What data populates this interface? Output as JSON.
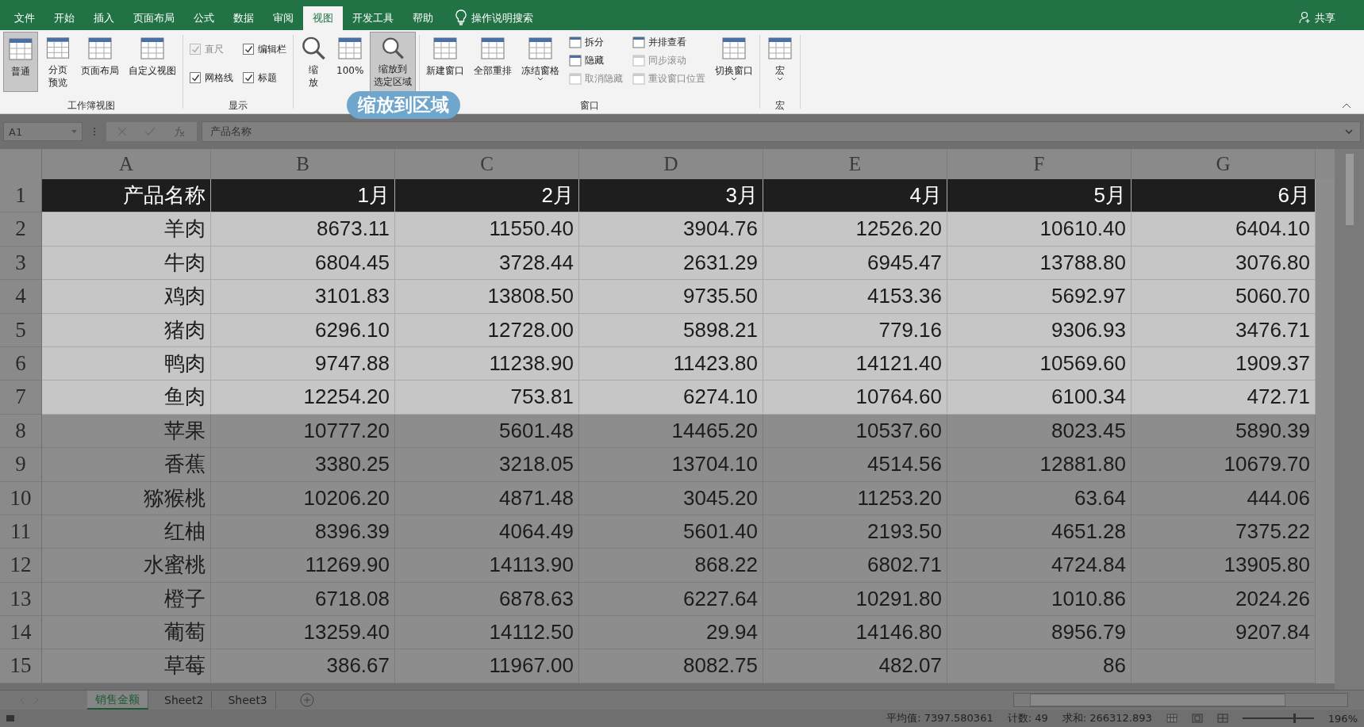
{
  "tabs": [
    {
      "label": "文件",
      "selected": false
    },
    {
      "label": "开始",
      "selected": false
    },
    {
      "label": "插入",
      "selected": false
    },
    {
      "label": "页面布局",
      "selected": false
    },
    {
      "label": "公式",
      "selected": false
    },
    {
      "label": "数据",
      "selected": false
    },
    {
      "label": "审阅",
      "selected": false
    },
    {
      "label": "视图",
      "selected": true
    },
    {
      "label": "开发工具",
      "selected": false
    },
    {
      "label": "帮助",
      "selected": false
    }
  ],
  "tell_me": "操作说明搜索",
  "share": "共享",
  "ribbon_groups": [
    {
      "label": "工作簿视图",
      "columns": [
        [
          {
            "kind": "large",
            "label": [
              "普通"
            ],
            "selected": true,
            "caret": false
          }
        ],
        [
          {
            "kind": "large",
            "label": [
              "分页",
              "预览"
            ],
            "selected": false,
            "caret": false
          }
        ],
        [
          {
            "kind": "large",
            "label": [
              "页面布局"
            ],
            "selected": false,
            "caret": false
          }
        ],
        [
          {
            "kind": "large",
            "label": [
              "自定义视图"
            ],
            "selected": false,
            "caret": false
          }
        ]
      ]
    },
    {
      "label": "显示",
      "columns": [
        [
          {
            "kind": "check",
            "label": "直尺",
            "checked": true,
            "disabled": true
          },
          {
            "kind": "check",
            "label": "网格线",
            "checked": true,
            "disabled": false
          }
        ],
        [
          {
            "kind": "check",
            "label": "编辑栏",
            "checked": true,
            "disabled": false
          },
          {
            "kind": "check",
            "label": "标题",
            "checked": true,
            "disabled": false
          }
        ]
      ]
    },
    {
      "columns": [
        [
          {
            "kind": "zoom",
            "label": [
              "缩",
              "放"
            ],
            "selected": false,
            "caret": false
          }
        ],
        [
          {
            "kind": "large",
            "label": [
              "100%"
            ],
            "selected": false,
            "caret": false
          }
        ],
        [
          {
            "kind": "zoom",
            "label": [
              "缩放到",
              "选定区域"
            ],
            "selected": true,
            "caret": false
          }
        ]
      ]
    },
    {
      "label": "窗口",
      "columns": [
        [
          {
            "kind": "large",
            "label": [
              "新建窗口"
            ],
            "selected": false,
            "caret": false
          }
        ],
        [
          {
            "kind": "large",
            "label": [
              "全部重排"
            ],
            "selected": false,
            "caret": false
          }
        ],
        [
          {
            "kind": "large",
            "label": [
              "冻结窗格"
            ],
            "selected": false,
            "caret": true
          }
        ],
        [
          {
            "kind": "small",
            "label": "拆分",
            "disabled": false
          },
          {
            "kind": "small",
            "label": "隐藏",
            "disabled": false
          },
          {
            "kind": "small",
            "label": "取消隐藏",
            "disabled": true
          }
        ],
        [
          {
            "kind": "small",
            "label": "并排查看",
            "disabled": false
          },
          {
            "kind": "small",
            "label": "同步滚动",
            "disabled": true
          },
          {
            "kind": "small",
            "label": "重设窗口位置",
            "disabled": true
          }
        ],
        [
          {
            "kind": "large",
            "label": [
              "切换窗口"
            ],
            "selected": false,
            "caret": true
          }
        ]
      ]
    },
    {
      "label": "宏",
      "columns": [
        [
          {
            "kind": "large",
            "label": [
              "宏"
            ],
            "selected": false,
            "caret": true
          }
        ]
      ]
    }
  ],
  "callout": "缩放到区域",
  "formula_bar": {
    "name_box": "A1",
    "content": "产品名称"
  },
  "columns": [
    "A",
    "B",
    "C",
    "D",
    "E",
    "F",
    "G"
  ],
  "rows": [
    {
      "number": "1",
      "kind": "header",
      "selected": true,
      "cells": [
        "产品名称",
        "1月",
        "2月",
        "3月",
        "4月",
        "5月",
        "6月"
      ]
    },
    {
      "number": "2",
      "kind": "data",
      "selected": true,
      "cells": [
        "羊肉",
        "8673.11",
        "11550.40",
        "3904.76",
        "12526.20",
        "10610.40",
        "6404.10"
      ]
    },
    {
      "number": "3",
      "kind": "data",
      "selected": true,
      "cells": [
        "牛肉",
        "6804.45",
        "3728.44",
        "2631.29",
        "6945.47",
        "13788.80",
        "3076.80"
      ]
    },
    {
      "number": "4",
      "kind": "data",
      "selected": true,
      "cells": [
        "鸡肉",
        "3101.83",
        "13808.50",
        "9735.50",
        "4153.36",
        "5692.97",
        "5060.70"
      ]
    },
    {
      "number": "5",
      "kind": "data",
      "selected": true,
      "cells": [
        "猪肉",
        "6296.10",
        "12728.00",
        "5898.21",
        "779.16",
        "9306.93",
        "3476.71"
      ]
    },
    {
      "number": "6",
      "kind": "data",
      "selected": true,
      "cells": [
        "鸭肉",
        "9747.88",
        "11238.90",
        "11423.80",
        "14121.40",
        "10569.60",
        "1909.37"
      ]
    },
    {
      "number": "7",
      "kind": "data",
      "selected": true,
      "cells": [
        "鱼肉",
        "12254.20",
        "753.81",
        "6274.10",
        "10764.60",
        "6100.34",
        "472.71"
      ]
    },
    {
      "number": "8",
      "kind": "data",
      "selected": false,
      "cells": [
        "苹果",
        "10777.20",
        "5601.48",
        "14465.20",
        "10537.60",
        "8023.45",
        "5890.39"
      ]
    },
    {
      "number": "9",
      "kind": "data",
      "selected": false,
      "cells": [
        "香蕉",
        "3380.25",
        "3218.05",
        "13704.10",
        "4514.56",
        "12881.80",
        "10679.70"
      ]
    },
    {
      "number": "10",
      "kind": "data",
      "selected": false,
      "cells": [
        "猕猴桃",
        "10206.20",
        "4871.48",
        "3045.20",
        "11253.20",
        "63.64",
        "444.06"
      ]
    },
    {
      "number": "11",
      "kind": "data",
      "selected": false,
      "cells": [
        "红柚",
        "8396.39",
        "4064.49",
        "5601.40",
        "2193.50",
        "4651.28",
        "7375.22"
      ]
    },
    {
      "number": "12",
      "kind": "data",
      "selected": false,
      "cells": [
        "水蜜桃",
        "11269.90",
        "14113.90",
        "868.22",
        "6802.71",
        "4724.84",
        "13905.80"
      ]
    },
    {
      "number": "13",
      "kind": "data",
      "selected": false,
      "cells": [
        "橙子",
        "6718.08",
        "6878.63",
        "6227.64",
        "10291.80",
        "1010.86",
        "2024.26"
      ]
    },
    {
      "number": "14",
      "kind": "data",
      "selected": false,
      "cells": [
        "葡萄",
        "13259.40",
        "14112.50",
        "29.94",
        "14146.80",
        "8956.79",
        "9207.84"
      ]
    },
    {
      "number": "15",
      "kind": "data",
      "selected": false,
      "cells": [
        "草莓",
        "386.67",
        "11967.00",
        "8082.75",
        "482.07",
        "86"
      ]
    }
  ],
  "sheet_tabs": [
    {
      "label": "销售金额",
      "selected": true
    },
    {
      "label": "Sheet2",
      "selected": false
    },
    {
      "label": "Sheet3",
      "selected": false
    }
  ],
  "status_bar": {
    "average": "平均值: 7397.580361",
    "count": "计数: 49",
    "sum": "求和: 266312.893",
    "zoom": "196%",
    "zoom_level": {
      "level": 0.72
    }
  }
}
